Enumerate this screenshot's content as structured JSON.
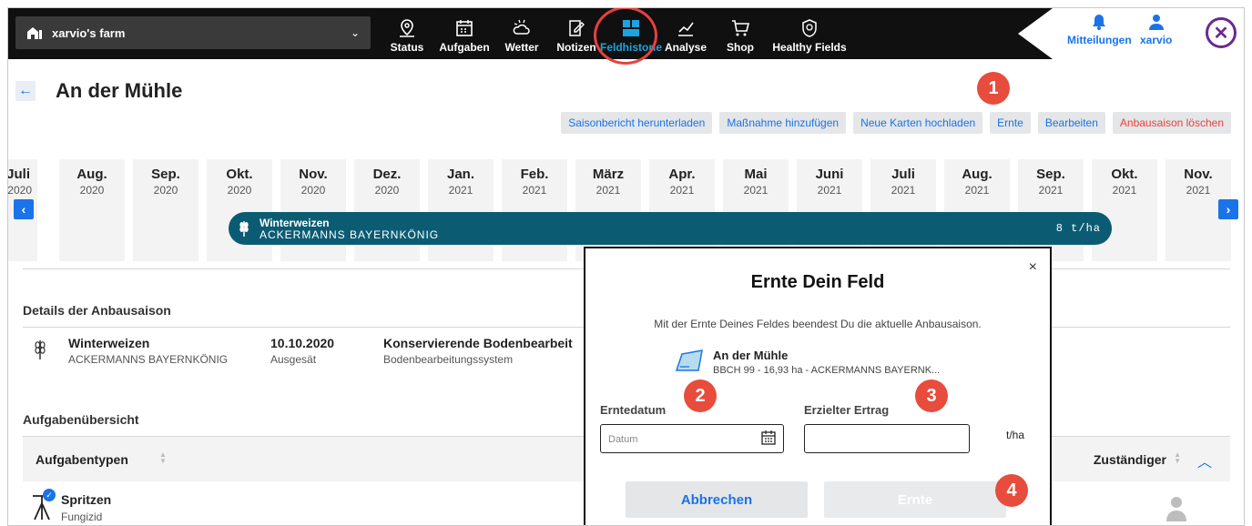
{
  "farm": {
    "name": "xarvio's farm"
  },
  "nav": {
    "items": [
      {
        "label": "Status",
        "icon": "map-pin-icon"
      },
      {
        "label": "Aufgaben",
        "icon": "calendar-icon"
      },
      {
        "label": "Wetter",
        "icon": "weather-icon"
      },
      {
        "label": "Notizen",
        "icon": "notes-icon"
      },
      {
        "label": "Feldhistorie",
        "icon": "field-history-icon",
        "active": true
      },
      {
        "label": "Analyse",
        "icon": "analyse-icon"
      },
      {
        "label": "Shop",
        "icon": "cart-icon"
      },
      {
        "label": "Healthy Fields",
        "icon": "healthy-fields-icon"
      }
    ],
    "notifications_label": "Mitteilungen",
    "user_label": "xarvio"
  },
  "page": {
    "title": "An der Mühle",
    "actions": {
      "saisonbericht": "Saisonbericht herunterladen",
      "massnahme": "Maßnahme hinzufügen",
      "karten": "Neue Karten hochladen",
      "ernte": "Ernte",
      "bearbeiten": "Bearbeiten",
      "loeschen": "Anbausaison löschen"
    }
  },
  "timeline": {
    "months": [
      {
        "m": "Juli",
        "y": "2020"
      },
      {
        "m": "Aug.",
        "y": "2020"
      },
      {
        "m": "Sep.",
        "y": "2020"
      },
      {
        "m": "Okt.",
        "y": "2020"
      },
      {
        "m": "Nov.",
        "y": "2020"
      },
      {
        "m": "Dez.",
        "y": "2020"
      },
      {
        "m": "Jan.",
        "y": "2021"
      },
      {
        "m": "Feb.",
        "y": "2021"
      },
      {
        "m": "März",
        "y": "2021"
      },
      {
        "m": "Apr.",
        "y": "2021"
      },
      {
        "m": "Mai",
        "y": "2021"
      },
      {
        "m": "Juni",
        "y": "2021"
      },
      {
        "m": "Juli",
        "y": "2021"
      },
      {
        "m": "Aug.",
        "y": "2021"
      },
      {
        "m": "Sep.",
        "y": "2021"
      },
      {
        "m": "Okt.",
        "y": "2021"
      },
      {
        "m": "Nov.",
        "y": "2021"
      }
    ],
    "crop": {
      "name": "Winterweizen",
      "variety": "ACKERMANNS BAYERNKÖNIG",
      "yield": "8 t/ha"
    }
  },
  "details": {
    "heading": "Details der Anbausaison",
    "crop": "Winterweizen",
    "variety": "ACKERMANNS BAYERNKÖNIG",
    "date": "10.10.2020",
    "date_label": "Ausgesät",
    "tillage": "Konservierende Bodenbearbeit",
    "tillage_label": "Bodenbearbeitungssystem"
  },
  "tasks": {
    "heading": "Aufgabenübersicht",
    "col_type": "Aufgabentypen",
    "col_owner": "Zuständiger",
    "rows": [
      {
        "name": "Spritzen",
        "type": "Fungizid"
      }
    ]
  },
  "modal": {
    "title": "Ernte Dein Feld",
    "description": "Mit der Ernte Deines Feldes beendest Du die aktuelle Anbausaison.",
    "field_name": "An der Mühle",
    "field_meta": "BBCH 99 - 16,93 ha - ACKERMANNS BAYERNK...",
    "date_label": "Erntedatum",
    "date_placeholder": "Datum",
    "yield_label": "Erzielter Ertrag",
    "yield_unit": "t/ha",
    "cancel": "Abbrechen",
    "confirm": "Ernte",
    "close": "×"
  },
  "badges": [
    "1",
    "2",
    "3",
    "4"
  ],
  "colors": {
    "accent": "#1a73e8",
    "topbar": "#101010",
    "badge": "#e74c3c",
    "crop_bar": "#0b5c73",
    "danger": "#e8413d"
  }
}
